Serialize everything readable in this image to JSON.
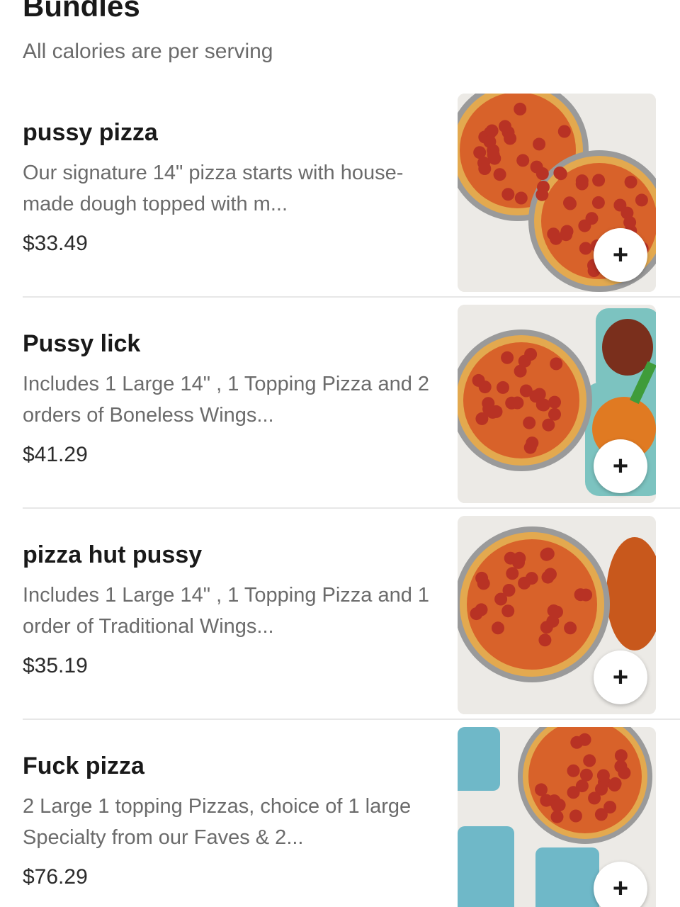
{
  "section": {
    "title": "Bundles",
    "subtitle": "All calories are per serving"
  },
  "items": [
    {
      "name": "pussy pizza",
      "description": "Our signature 14\" pizza starts with house-made dough topped with m...",
      "price": "$33.49",
      "add_icon": "plus-icon",
      "add_symbol": "+"
    },
    {
      "name": "Pussy lick",
      "description": "Includes 1 Large 14\" , 1 Topping Pizza and 2 orders of Boneless Wings...",
      "price": "$41.29",
      "add_icon": "plus-icon",
      "add_symbol": "+"
    },
    {
      "name": "pizza hut pussy",
      "description": "Includes 1 Large 14\" , 1 Topping Pizza and 1 order of Traditional Wings...",
      "price": "$35.19",
      "add_icon": "plus-icon",
      "add_symbol": "+"
    },
    {
      "name": "Fuck pizza",
      "description": "2 Large 1 topping Pizzas, choice of 1 large Specialty from our Faves & 2...",
      "price": "$76.29",
      "add_icon": "plus-icon",
      "add_symbol": "+"
    }
  ],
  "colors": {
    "text_primary": "#191919",
    "text_secondary": "#6b6b6b",
    "divider": "#e7e7e7",
    "crust": "#e3a94f",
    "sauce": "#d8622a",
    "pepperoni": "#c0392b"
  }
}
